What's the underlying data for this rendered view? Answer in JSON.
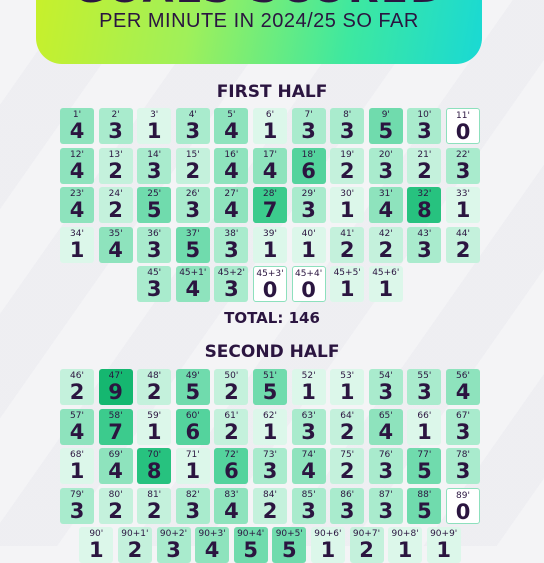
{
  "header": {
    "title": "GOALS SCORED",
    "subtitle": "PER MINUTE IN 2024/25 SO FAR"
  },
  "first_half": {
    "heading": "FIRST HALF",
    "total_label": "TOTAL: 146",
    "rows": [
      [
        [
          "1'",
          4
        ],
        [
          "2'",
          3
        ],
        [
          "3'",
          1
        ],
        [
          "4'",
          3
        ],
        [
          "5'",
          4
        ],
        [
          "6'",
          1
        ],
        [
          "7'",
          3
        ],
        [
          "8'",
          3
        ],
        [
          "9'",
          5
        ],
        [
          "10'",
          3
        ],
        [
          "11'",
          0
        ]
      ],
      [
        [
          "12'",
          4
        ],
        [
          "13'",
          2
        ],
        [
          "14'",
          3
        ],
        [
          "15'",
          2
        ],
        [
          "16'",
          4
        ],
        [
          "17'",
          4
        ],
        [
          "18'",
          6
        ],
        [
          "19'",
          2
        ],
        [
          "20'",
          3
        ],
        [
          "21'",
          2
        ],
        [
          "22'",
          3
        ]
      ],
      [
        [
          "23'",
          4
        ],
        [
          "24'",
          2
        ],
        [
          "25'",
          5
        ],
        [
          "26'",
          3
        ],
        [
          "27'",
          4
        ],
        [
          "28'",
          7
        ],
        [
          "29'",
          3
        ],
        [
          "30'",
          1
        ],
        [
          "31'",
          4
        ],
        [
          "32'",
          8
        ],
        [
          "33'",
          1
        ]
      ],
      [
        [
          "34'",
          1
        ],
        [
          "35'",
          4
        ],
        [
          "36'",
          3
        ],
        [
          "37'",
          5
        ],
        [
          "38'",
          3
        ],
        [
          "39'",
          1
        ],
        [
          "40'",
          1
        ],
        [
          "41'",
          2
        ],
        [
          "42'",
          2
        ],
        [
          "43'",
          3
        ],
        [
          "44'",
          2
        ]
      ],
      [
        [
          "45'",
          3
        ],
        [
          "45+1'",
          4
        ],
        [
          "45+2'",
          3
        ],
        [
          "45+3'",
          0
        ],
        [
          "45+4'",
          0
        ],
        [
          "45+5'",
          1
        ],
        [
          "45+6'",
          1
        ]
      ]
    ]
  },
  "second_half": {
    "heading": "SECOND HALF",
    "rows": [
      [
        [
          "46'",
          2
        ],
        [
          "47'",
          9
        ],
        [
          "48'",
          2
        ],
        [
          "49'",
          5
        ],
        [
          "50'",
          2
        ],
        [
          "51'",
          5
        ],
        [
          "52'",
          1
        ],
        [
          "53'",
          1
        ],
        [
          "54'",
          3
        ],
        [
          "55'",
          3
        ],
        [
          "56'",
          4
        ]
      ],
      [
        [
          "57'",
          4
        ],
        [
          "58'",
          7
        ],
        [
          "59'",
          1
        ],
        [
          "60'",
          6
        ],
        [
          "61'",
          2
        ],
        [
          "62'",
          1
        ],
        [
          "63'",
          3
        ],
        [
          "64'",
          2
        ],
        [
          "65'",
          4
        ],
        [
          "66'",
          1
        ],
        [
          "67'",
          3
        ]
      ],
      [
        [
          "68'",
          1
        ],
        [
          "69'",
          4
        ],
        [
          "70'",
          8
        ],
        [
          "71'",
          1
        ],
        [
          "72'",
          6
        ],
        [
          "73'",
          3
        ],
        [
          "74'",
          4
        ],
        [
          "75'",
          2
        ],
        [
          "76'",
          3
        ],
        [
          "77'",
          5
        ],
        [
          "78'",
          3
        ]
      ],
      [
        [
          "79'",
          3
        ],
        [
          "80'",
          2
        ],
        [
          "81'",
          2
        ],
        [
          "82'",
          3
        ],
        [
          "83'",
          4
        ],
        [
          "84'",
          2
        ],
        [
          "85'",
          3
        ],
        [
          "86'",
          3
        ],
        [
          "87'",
          3
        ],
        [
          "88'",
          5
        ],
        [
          "89'",
          0
        ]
      ],
      [
        [
          "90'",
          1
        ],
        [
          "90+1'",
          2
        ],
        [
          "90+2'",
          3
        ],
        [
          "90+3'",
          4
        ],
        [
          "90+4'",
          5
        ],
        [
          "90+5'",
          5
        ],
        [
          "90+6'",
          1
        ],
        [
          "90+7'",
          2
        ],
        [
          "90+8'",
          1
        ],
        [
          "90+9'",
          1
        ]
      ]
    ]
  }
}
